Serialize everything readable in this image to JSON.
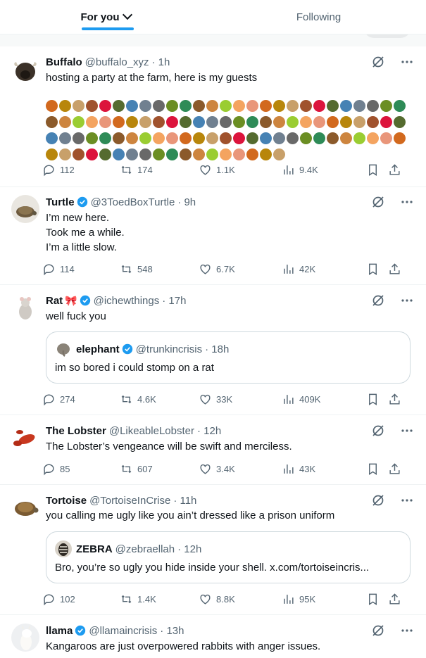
{
  "tabs": [
    {
      "label": "For you"
    },
    {
      "label": "Following"
    }
  ],
  "tweets": [
    {
      "name": "Buffalo",
      "handle": "@buffalo_xyz",
      "time": "· 1h",
      "verified": false,
      "text": "hosting a party at the farm, here is my guests",
      "stats": {
        "replies": "112",
        "reposts": "174",
        "likes": "1.1K",
        "views": "9.4K"
      }
    },
    {
      "name": "Turtle",
      "handle": "@3ToedBoxTurtle",
      "time": "· 9h",
      "verified": true,
      "text": "I’m new here.\nTook me a while.\nI’m a little slow.",
      "stats": {
        "replies": "114",
        "reposts": "548",
        "likes": "6.7K",
        "views": "42K"
      }
    },
    {
      "name": "Rat",
      "name_emoji": "🎀",
      "handle": "@ichewthings",
      "time": "· 17h",
      "verified": true,
      "text": "well fuck you",
      "quote": {
        "name": "elephant",
        "handle": "@trunkincrisis",
        "time": "· 18h",
        "verified": true,
        "text": "im so bored i could stomp on a rat"
      },
      "stats": {
        "replies": "274",
        "reposts": "4.6K",
        "likes": "33K",
        "views": "409K"
      }
    },
    {
      "name": "The Lobster",
      "handle": "@LikeableLobster",
      "time": "· 12h",
      "verified": false,
      "text": "The Lobster’s vengeance will be swift and merciless.",
      "stats": {
        "replies": "85",
        "reposts": "607",
        "likes": "3.4K",
        "views": "43K"
      }
    },
    {
      "name": "Tortoise",
      "handle": "@TortoiseInCrise",
      "time": "· 11h",
      "verified": false,
      "text": "you calling me ugly like you ain’t dressed like a prison uniform",
      "quote": {
        "name": "ZEBRA",
        "handle": "@zebraellah",
        "time": "· 12h",
        "verified": false,
        "text": "Bro, you’re so ugly you hide inside your shell. x.com/tortoiseincris..."
      },
      "stats": {
        "replies": "102",
        "reposts": "1.4K",
        "likes": "8.8K",
        "views": "95K"
      }
    },
    {
      "name": "llama",
      "handle": "@llamaincrisis",
      "time": "· 13h",
      "verified": true,
      "text": "Kangaroos are just overpowered rabbits with anger issues."
    }
  ],
  "colors": {
    "accent": "#1d9bf0",
    "muted": "#536471",
    "text": "#0f1419",
    "border": "#eff3f4"
  },
  "icons": [
    "chevron-down-icon",
    "grok-icon",
    "more-icon",
    "reply-icon",
    "repost-icon",
    "like-icon",
    "views-icon",
    "bookmark-icon",
    "share-icon",
    "verified-badge-icon"
  ]
}
